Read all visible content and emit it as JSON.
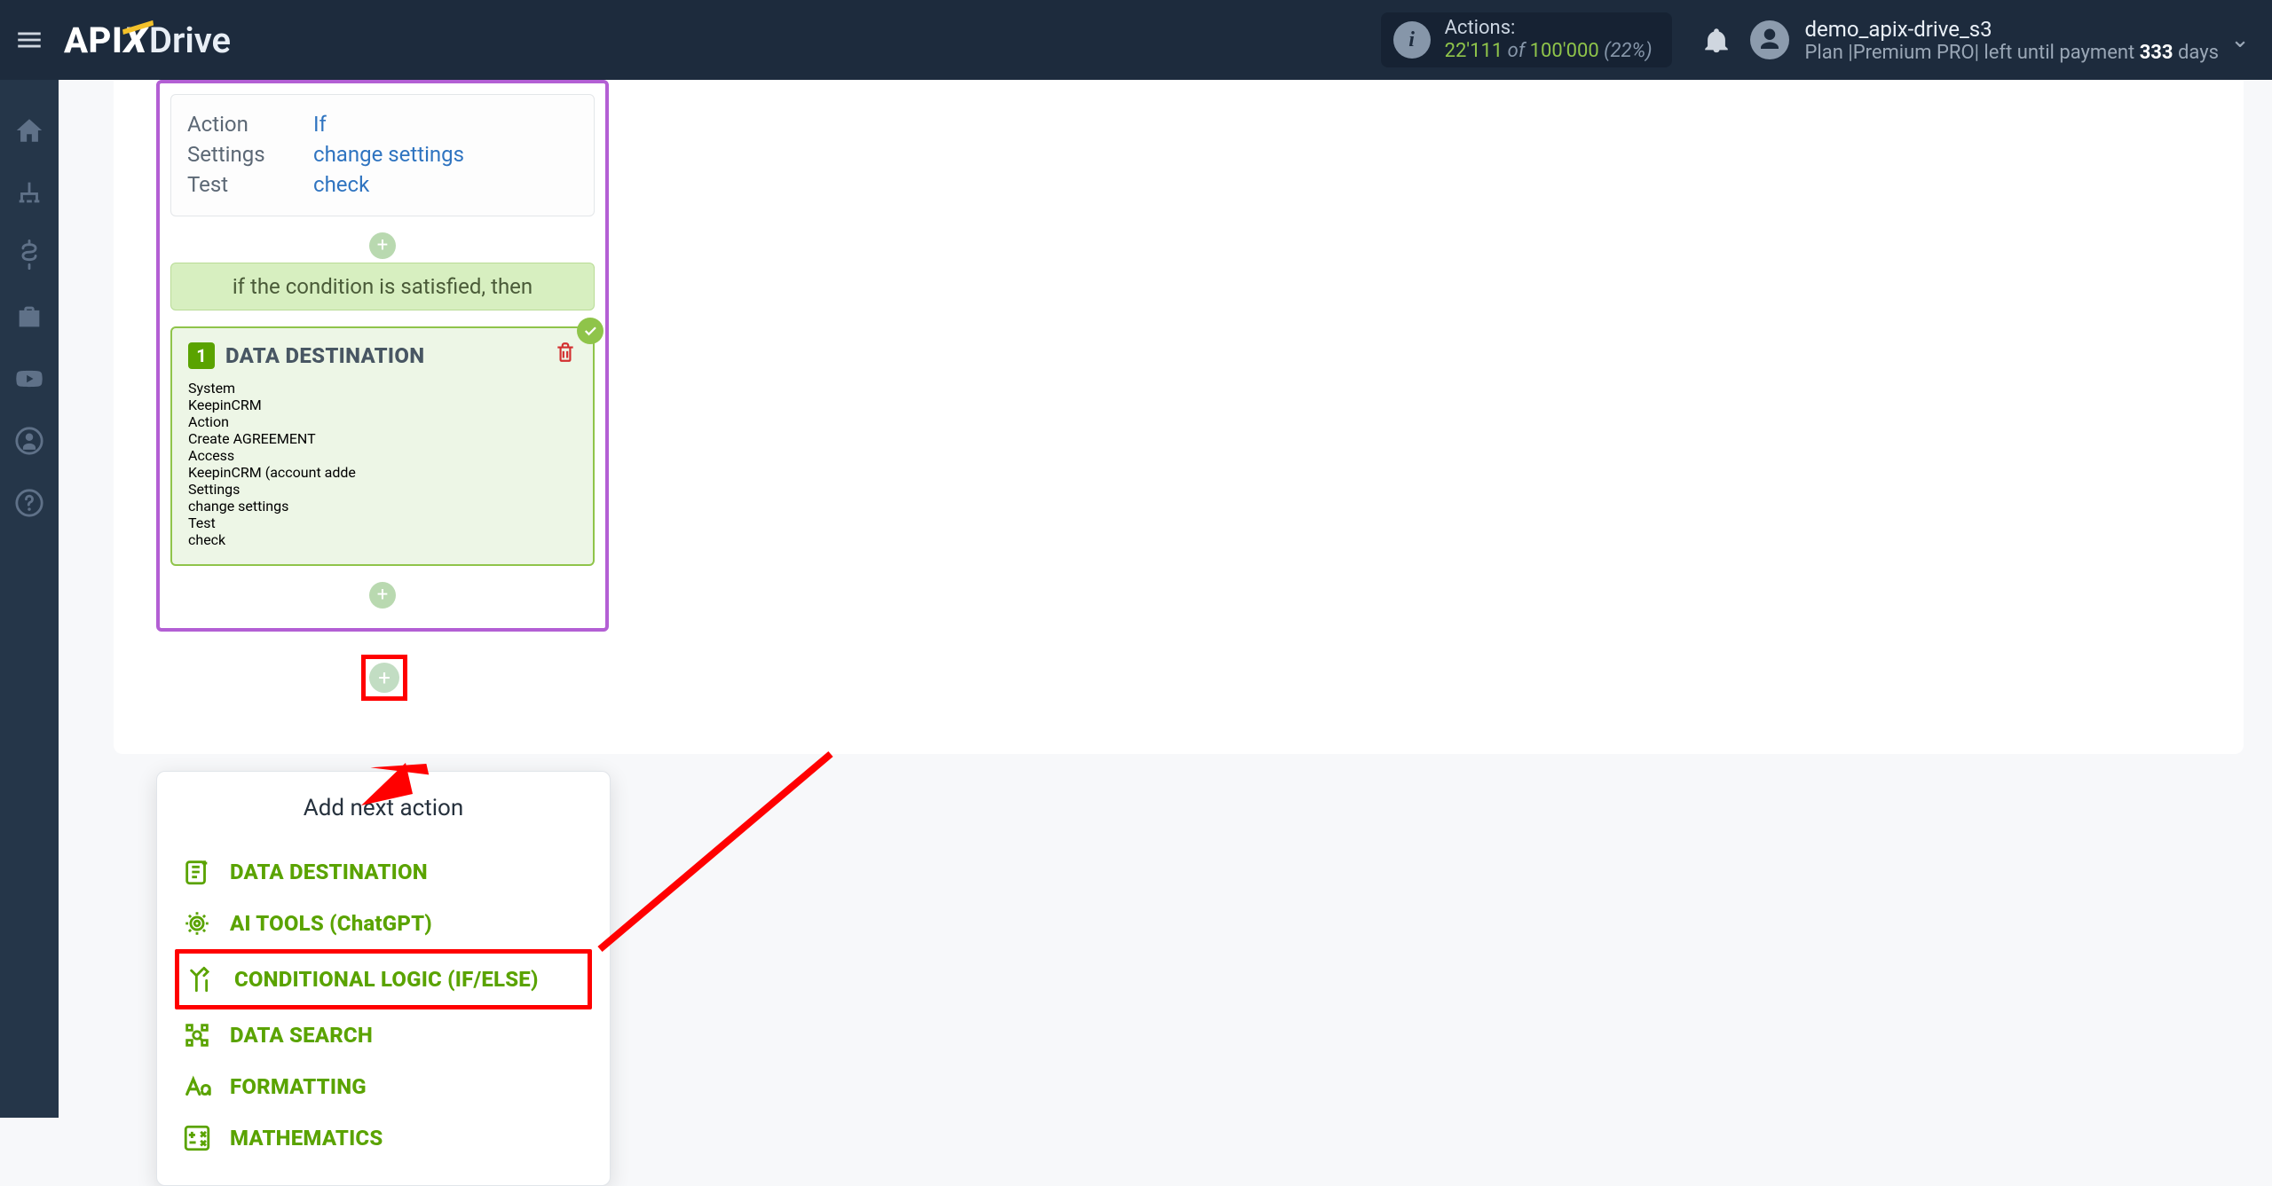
{
  "brand": {
    "api": "API",
    "x": "X",
    "drive": "Drive"
  },
  "topbar": {
    "actions_label": "Actions:",
    "actions_used": "22'111",
    "actions_of": " of ",
    "actions_total": "100'000",
    "actions_pct": "(22%)"
  },
  "user": {
    "name": "demo_apix-drive_s3",
    "plan_prefix": "Plan |Premium PRO| left until payment ",
    "days": "333",
    "plan_suffix": " days"
  },
  "card1": {
    "labels": {
      "action": "Action",
      "settings": "Settings",
      "test": "Test"
    },
    "values": {
      "action": "If",
      "settings": "change settings",
      "test": "check"
    }
  },
  "cond_text": "if the condition is satisfied, then",
  "dest": {
    "num": "1",
    "title": "DATA DESTINATION",
    "labels": {
      "system": "System",
      "action": "Action",
      "access": "Access",
      "settings": "Settings",
      "test": "Test"
    },
    "values": {
      "system": "KeepinCRM",
      "action": "Create AGREEMENT",
      "access": "KeepinCRM (account adde",
      "settings": "change settings",
      "test": "check"
    }
  },
  "popup": {
    "title": "Add next action",
    "items": [
      "DATA DESTINATION",
      "AI TOOLS (ChatGPT)",
      "CONDITIONAL LOGIC (IF/ELSE)",
      "DATA SEARCH",
      "FORMATTING",
      "MATHEMATICS"
    ]
  },
  "icons": {
    "side": [
      "home",
      "sitemap",
      "dollar",
      "briefcase",
      "youtube",
      "user",
      "help"
    ]
  }
}
